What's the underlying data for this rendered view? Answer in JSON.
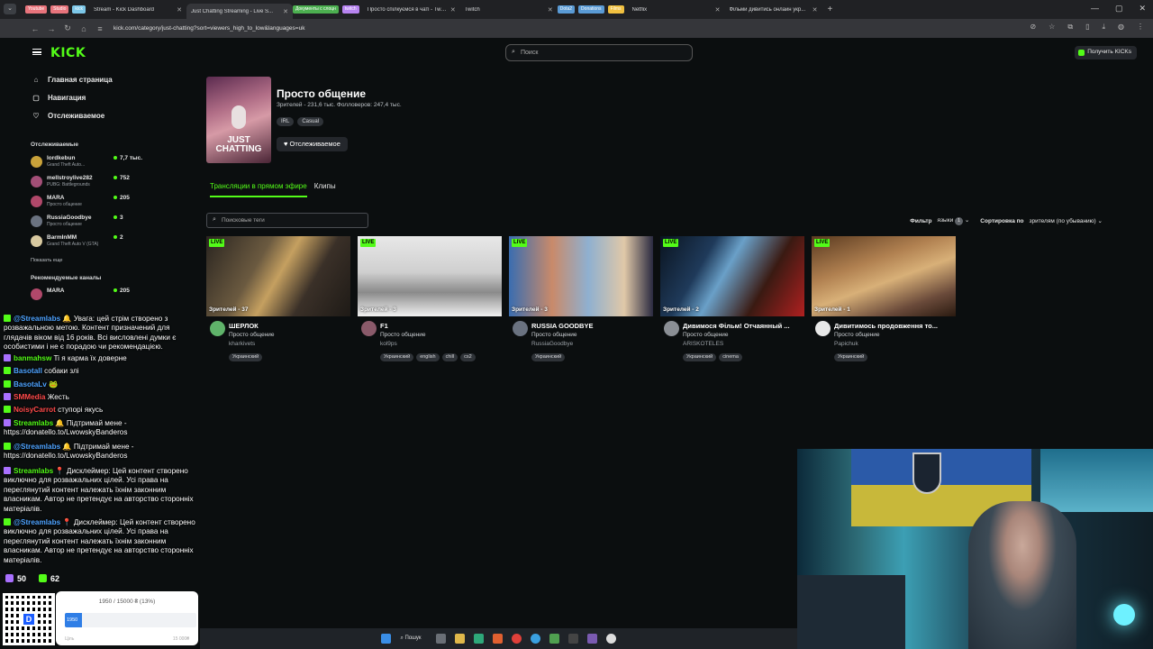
{
  "browser": {
    "groups": [
      {
        "label": "Youtube",
        "color": "#e8747c"
      },
      {
        "label": "Studio",
        "color": "#e8747c"
      },
      {
        "label": "kick",
        "color": "#7cc7e8"
      }
    ],
    "tabs": [
      {
        "label": "Stream - Kick Dashboard",
        "active": false
      },
      {
        "label": "Just Chatting Streaming - Live S...",
        "active": true
      },
      {
        "label": "Документы с слоцн",
        "active": false,
        "group": true,
        "color": "#4caf50"
      },
      {
        "label": "twitch",
        "active": false,
        "group": true,
        "color": "#b784f0"
      },
      {
        "label": "Просто спілкуємся в чаті - Twit...",
        "active": false
      },
      {
        "label": "Twitch",
        "active": false
      },
      {
        "label": "Dota2",
        "active": false,
        "group": true,
        "color": "#5a9bd5"
      },
      {
        "label": "Donations",
        "active": false,
        "group": true,
        "color": "#5a9bd5"
      },
      {
        "label": "Films",
        "active": false,
        "group": true,
        "color": "#f0c040"
      },
      {
        "label": "Netflix",
        "active": false
      },
      {
        "label": "Фільми дивитись онлайн укр...",
        "active": false
      }
    ],
    "url": "kick.com/category/just-chatting?sort=viewers_high_to_low&languages=uk"
  },
  "header": {
    "logo": "KICK",
    "search_placeholder": "Поиск",
    "kicks_button": "Получить KICKs"
  },
  "sidebar": {
    "nav": [
      {
        "label": "Главная страница",
        "icon": "home-icon",
        "glyph": "⌂"
      },
      {
        "label": "Навигация",
        "icon": "browse-icon",
        "glyph": "▢"
      },
      {
        "label": "Отслеживаемое",
        "icon": "heart-icon",
        "glyph": "♡"
      }
    ],
    "following_title": "Отслеживаемые",
    "following": [
      {
        "name": "lordkebun",
        "game": "Grand Theft Auto...",
        "viewers": "7,7 тыс.",
        "color": "#c9a23a"
      },
      {
        "name": "mellstroylive282",
        "game": "PUBG: Battlegrounds",
        "viewers": "752",
        "color": "#a34f77"
      },
      {
        "name": "MARA",
        "game": "Просто общение",
        "viewers": "205",
        "color": "#b0486a"
      },
      {
        "name": "RussiaGoodbye",
        "game": "Просто общение",
        "viewers": "3",
        "color": "#6a7280"
      },
      {
        "name": "BarmInMM",
        "game": "Grand Theft Auto V (GTA)",
        "viewers": "2",
        "color": "#d8c9a0"
      }
    ],
    "show_more": "Показать еще",
    "recommended_title": "Рекомендуемые каналы",
    "recommended": [
      {
        "name": "MARA",
        "game": "",
        "viewers": "205",
        "color": "#b0486a"
      }
    ]
  },
  "category": {
    "image_label": "JUST CHATTING",
    "title": "Просто общение",
    "stats": "Зрителей - 231,6 тыс.   Фолловеров: 247,4 тыс.",
    "tags": [
      "IRL",
      "Casual"
    ],
    "follow_label": "Отслеживаемое"
  },
  "content_tabs": [
    "Трансляции в прямом эфире",
    "Клипы"
  ],
  "filters": {
    "tag_search_placeholder": "Поисковые теги",
    "filter_label": "Фильтр",
    "language_label": "языки",
    "language_count": "1",
    "sort_label": "Сортировка по",
    "sort_value": "зрителям (по убыванию)"
  },
  "streams": [
    {
      "live": "LIVE",
      "viewers": "Зрителей - 37",
      "title": "ШЕРЛОК",
      "category": "Просто общение",
      "user": "kharkivets",
      "tags": [
        "Украинский"
      ],
      "thumb": "linear-gradient(120deg,#2a2520 0%,#6b5a40 35%,#c5a060 50%,#3a3028 70%,#1e1a16 100%)",
      "avatar": "#5fb36a"
    },
    {
      "live": "LIVE",
      "viewers": "Зрителей - 3",
      "title": "F1",
      "category": "Просто общение",
      "user": "kol9ps",
      "tags": [
        "Украинский",
        "english",
        "chill",
        "cs2"
      ],
      "thumb": "linear-gradient(180deg,#e8e8e8 0%,#cfcfcf 45%,#8a8a8a 70%,#f2f2f2 100%)",
      "avatar": "#8a5a6a"
    },
    {
      "live": "LIVE",
      "viewers": "Зрителей - 3",
      "title": "RUSSIA GOODBYE",
      "category": "Просто общение",
      "user": "RussiaGoodbye",
      "tags": [
        "Украинский"
      ],
      "thumb": "linear-gradient(90deg,#3a6db0 0%,#c98a6a 30%,#8fb0d0 55%,#e0c8a8 80%,#2a2a40 100%)",
      "avatar": "#6a7280"
    },
    {
      "live": "LIVE",
      "viewers": "Зрителей - 2",
      "title": "Дивимося Фільм! Отчаянный ...",
      "category": "Просто общение",
      "user": "ARISKOTELES",
      "tags": [
        "Украинский",
        "cinema"
      ],
      "thumb": "linear-gradient(120deg,#0a1420 0%,#1f3a5a 30%,#6aa0c8 45%,#3a1a12 70%,#b02020 100%)",
      "avatar": "#8b8f95"
    },
    {
      "live": "LIVE",
      "viewers": "Зрителей - 1",
      "title": "Дивитимось продовження то...",
      "category": "Просто общение",
      "user": "Papichuk",
      "tags": [
        "Украинский"
      ],
      "thumb": "linear-gradient(160deg,#5a3a20 0%,#b08050 35%,#d8b078 55%,#6a4a3a 80%,#2a1a10 100%)",
      "avatar": "#e8e8e8"
    }
  ],
  "chat": [
    {
      "icon": "#53fc18",
      "user": "@Streamlabs",
      "ucls": "u-blue",
      "text": " 🔔 Увага: цей стрім створено з розважальною метою. Контент призначений для глядачів віком від 16 років. Всі висловлені думки є особистими і не є порадою чи рекомендацією."
    },
    {
      "icon": "#a970ff",
      "user": "banmahsw",
      "ucls": "u-green",
      "text": " Ti я карма їх доверне"
    },
    {
      "icon": "#53fc18",
      "user": "Basotall",
      "ucls": "u-blue",
      "text": " собаки злі"
    },
    {
      "icon": "#53fc18",
      "user": "BasotaLv",
      "ucls": "u-blue",
      "text": " 🐸"
    },
    {
      "icon": "#a970ff",
      "user": "SMMedia",
      "ucls": "u-red",
      "text": " Жесть"
    },
    {
      "icon": "#53fc18",
      "user": "NoisyCarrot",
      "ucls": "u-red",
      "text": " ступорі якусь"
    },
    {
      "icon": "#a970ff",
      "user": "Streamlabs",
      "ucls": "u-green",
      "text": " 🔔 Підтримай мене - https://donatello.to/LwowskyBanderos"
    },
    {
      "icon": "#53fc18",
      "user": "@Streamlabs",
      "ucls": "u-blue",
      "text": " 🔔 Підтримай мене - https://donatello.to/LwowskyBanderos"
    },
    {
      "icon": "#a970ff",
      "user": "Streamlabs",
      "ucls": "u-green",
      "text": " 📍 Дисклеймер: Цей контент створено виключно для розважальних цілей. Усі права на переглянутий контент належать їхнім законним власникам. Автор не претендує на авторство сторонніх матеріалів."
    },
    {
      "icon": "#53fc18",
      "user": "@Streamlabs",
      "ucls": "u-blue",
      "text": " 📍 Дисклеймер: Цей контент створено виключно для розважальних цілей. Усі права на переглянутий контент належать їхнім законним власникам. Автор не претендує на авторство сторонніх матеріалів."
    }
  ],
  "chat_counts": {
    "twitch": "50",
    "kick": "62",
    "twitch_color": "#a970ff",
    "kick_color": "#53fc18"
  },
  "donation_goal": {
    "text": "1950 / 15000 ₴ (13%)",
    "progress": 0.13,
    "fill_label": "1950",
    "start": "Ціль",
    "end": "15 000₴"
  },
  "taskbar": {
    "search_label": "Пошук"
  }
}
